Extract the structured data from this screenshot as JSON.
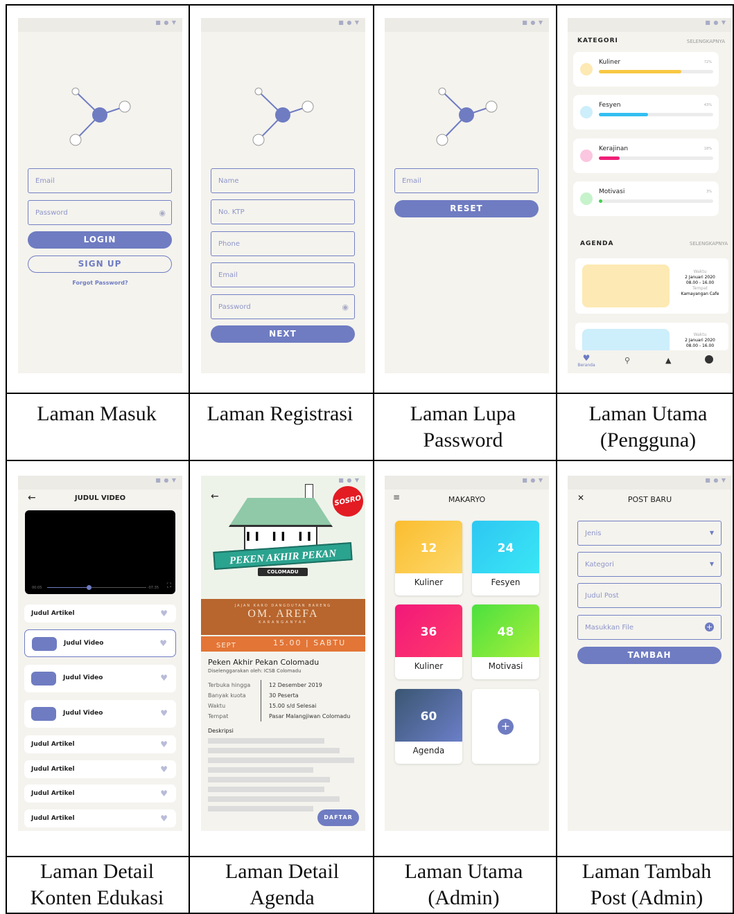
{
  "status_icons": "■ ● ▼",
  "captions": [
    "Laman Masuk",
    "Laman Registrasi",
    "Laman Lupa Password",
    "Laman Utama (Pengguna)",
    "Laman Detail Konten Edukasi",
    "Laman Detail Agenda",
    "Laman Utama (Admin)",
    "Laman Tambah Post (Admin)"
  ],
  "login": {
    "email": "Email",
    "password": "Password",
    "login": "LOGIN",
    "signup": "SIGN UP",
    "forgot": "Forgot Password?"
  },
  "register": {
    "name": "Name",
    "ktp": "No. KTP",
    "phone": "Phone",
    "email": "Email",
    "password": "Password",
    "next": "NEXT"
  },
  "reset": {
    "email": "Email",
    "button": "RESET"
  },
  "home": {
    "kategori": "KATEGORI",
    "more": "SELENGKAPNYA",
    "categories": [
      {
        "label": "Kuliner",
        "pct": "72%",
        "value": 72,
        "color": "#f8c843",
        "dot": "#fde9b3"
      },
      {
        "label": "Fesyen",
        "pct": "43%",
        "value": 43,
        "color": "#33bff0",
        "dot": "#cdeefb"
      },
      {
        "label": "Kerajinan",
        "pct": "18%",
        "value": 18,
        "color": "#ef1f77",
        "dot": "#fbc6e0"
      },
      {
        "label": "Motivasi",
        "pct": "3%",
        "value": 3,
        "color": "#3ed34f",
        "dot": "#c6f3cb"
      }
    ],
    "agenda": "AGENDA",
    "agenda_more": "SELENGKAPNYA",
    "waktu": "Waktu",
    "date": "2 Januari 2020",
    "time": "08.00 - 16.00",
    "tempat": "Tempat",
    "place": "Kamayangan Cafe",
    "nav": [
      "Beranda"
    ]
  },
  "video": {
    "title": "JUDUL VIDEO",
    "cur": "00:05",
    "rem": "-07:35",
    "rows": [
      {
        "label": "Judul Artikel",
        "thumb": false
      },
      {
        "label": "Judul Video",
        "thumb": true
      },
      {
        "label": "Judul Video",
        "thumb": true
      },
      {
        "label": "Judul Video",
        "thumb": true
      },
      {
        "label": "Judul Artikel",
        "thumb": false
      },
      {
        "label": "Judul Artikel",
        "thumb": false
      },
      {
        "label": "Judul Artikel",
        "thumb": false
      },
      {
        "label": "Judul Artikel",
        "thumb": false
      }
    ]
  },
  "agenda_detail": {
    "poster": {
      "brand": "SOSRO",
      "banner": "PEKEN AKHIR PEKAN",
      "sub": "COLOMADU",
      "small": "JAJAN KARO DANGDUTAN BARENG",
      "om": "OM. AREFA",
      "kar": "KARANGANYAR",
      "sept": "SEPT",
      "time": "15.00 | SABTU"
    },
    "title": "Peken Akhir Pekan Colomadu",
    "org": "Diselenggarakan oleh: ICSB Colomadu",
    "details": [
      {
        "k": "Terbuka hingga",
        "v": "12 Desember 2019"
      },
      {
        "k": "Banyak kuota",
        "v": "30 Peserta"
      },
      {
        "k": "Waktu",
        "v": "15.00 s/d Selesai"
      },
      {
        "k": "Tempat",
        "v": "Pasar Malangjiwan Colomadu"
      }
    ],
    "desc": "Deskripsi",
    "daftar": "DAFTAR"
  },
  "admin": {
    "title": "MAKARYO",
    "tiles": [
      {
        "n": "12",
        "label": "Kuliner",
        "g": "linear-gradient(135deg,#fbbd2f,#fcd86a)"
      },
      {
        "n": "24",
        "label": "Fesyen",
        "g": "linear-gradient(135deg,#2ec7f2,#3ae6f5)"
      },
      {
        "n": "36",
        "label": "Kuliner",
        "g": "linear-gradient(135deg,#f2187a,#ff3a6a)"
      },
      {
        "n": "48",
        "label": "Motivasi",
        "g": "linear-gradient(135deg,#4be03f,#a8ef3a)"
      },
      {
        "n": "60",
        "label": "Agenda",
        "g": "linear-gradient(135deg,#3a5672,#6b7fc8)"
      }
    ]
  },
  "post": {
    "title": "POST BARU",
    "jenis": "Jenis",
    "kategori": "Kategori",
    "judul": "Judul Post",
    "file": "Masukkan File",
    "button": "TAMBAH"
  }
}
